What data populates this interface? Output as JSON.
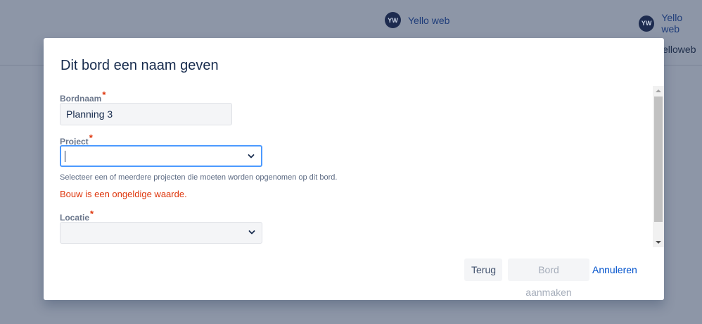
{
  "background": {
    "users": [
      {
        "initials": "YW",
        "name": "Yello web"
      },
      {
        "initials": "YW",
        "name": "Yello web"
      }
    ],
    "partial_text": "elloweb"
  },
  "dialog": {
    "title": "Dit bord een naam geven",
    "required_mark": "*",
    "board_name": {
      "label": "Bordnaam",
      "value": "Planning 3"
    },
    "project": {
      "label": "Project",
      "value": "",
      "help": "Selecteer een of meerdere projecten die moeten worden opgenomen op dit bord.",
      "error": "Bouw is een ongeldige waarde."
    },
    "location": {
      "label": "Locatie",
      "value": ""
    },
    "buttons": {
      "back": "Terug",
      "create": "Bord aanmaken",
      "cancel": "Annuleren"
    }
  },
  "colors": {
    "overlay": "#8d96a7",
    "error": "#de350b",
    "link": "#0052cc",
    "focus": "#4c9aff"
  }
}
